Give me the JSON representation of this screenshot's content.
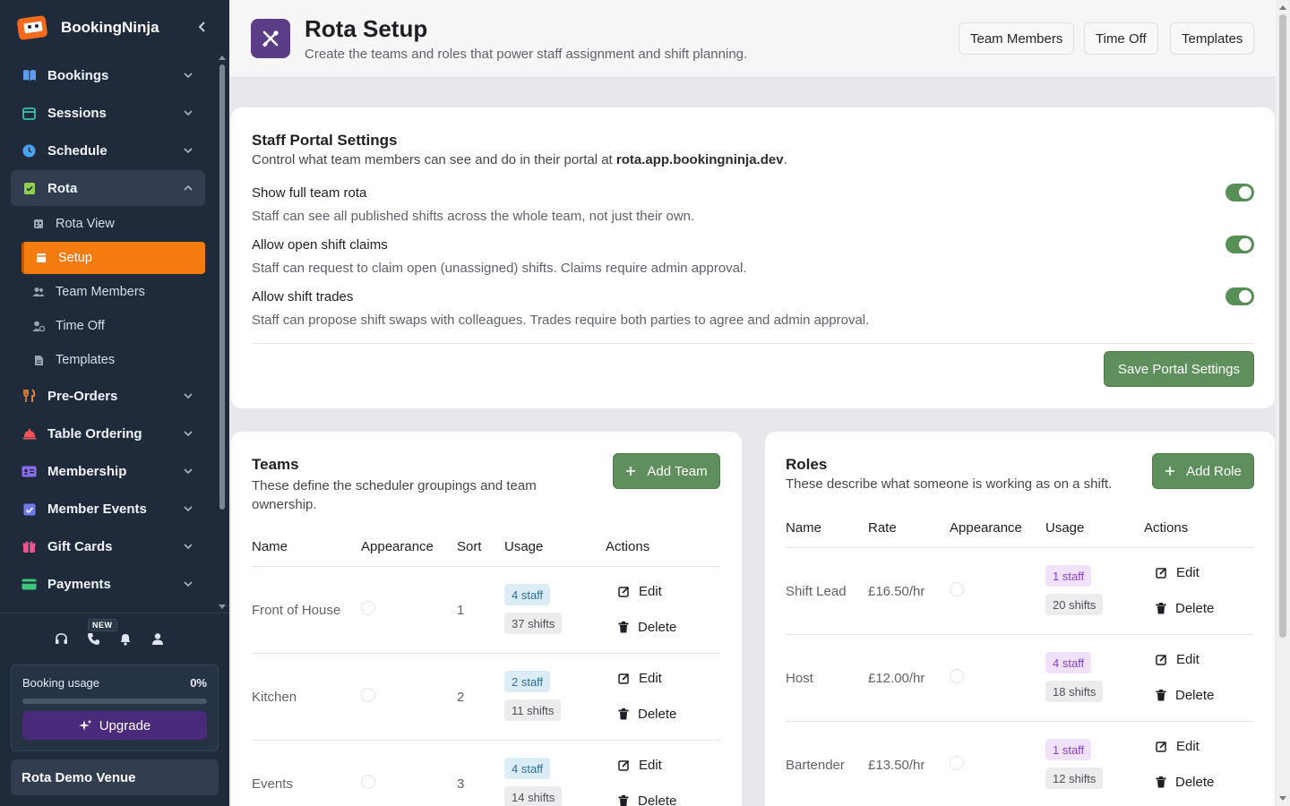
{
  "brand": {
    "name": "BookingNinja"
  },
  "sidebar": {
    "items": [
      {
        "label": "Bookings",
        "icon": "book-icon",
        "color": "#5b9bf0"
      },
      {
        "label": "Sessions",
        "icon": "calendar-icon",
        "color": "#36c2b4"
      },
      {
        "label": "Schedule",
        "icon": "clock-icon",
        "color": "#4aa3f0"
      },
      {
        "label": "Rota",
        "icon": "clipboard-check-icon",
        "color": "#8fd14f"
      },
      {
        "label": "Pre-Orders",
        "icon": "utensils-icon",
        "color": "#f28a2e"
      },
      {
        "label": "Table Ordering",
        "icon": "cloche-icon",
        "color": "#f2545b"
      },
      {
        "label": "Membership",
        "icon": "id-card-icon",
        "color": "#8b6cf0"
      },
      {
        "label": "Member Events",
        "icon": "calendar-check-icon",
        "color": "#6f7cf0"
      },
      {
        "label": "Gift Cards",
        "icon": "gift-icon",
        "color": "#e8558f"
      },
      {
        "label": "Payments",
        "icon": "credit-card-icon",
        "color": "#3ec67a"
      }
    ],
    "rota_sub": [
      {
        "label": "Rota View"
      },
      {
        "label": "Setup"
      },
      {
        "label": "Team Members"
      },
      {
        "label": "Time Off"
      },
      {
        "label": "Templates"
      }
    ],
    "new_badge": "NEW",
    "usage": {
      "label": "Booking usage",
      "percent_text": "0%",
      "percent": 0
    },
    "upgrade_label": "Upgrade",
    "venue": "Rota Demo Venue"
  },
  "header": {
    "title": "Rota Setup",
    "subtitle": "Create the teams and roles that power staff assignment and shift planning.",
    "buttons": [
      "Team Members",
      "Time Off",
      "Templates"
    ]
  },
  "portal": {
    "title": "Staff Portal Settings",
    "desc_prefix": "Control what team members can see and do in their portal at ",
    "domain": "rota.app.bookingninja.dev",
    "desc_suffix": ".",
    "settings": [
      {
        "label": "Show full team rota",
        "desc": "Staff can see all published shifts across the whole team, not just their own.",
        "enabled": true
      },
      {
        "label": "Allow open shift claims",
        "desc": "Staff can request to claim open (unassigned) shifts. Claims require admin approval.",
        "enabled": true
      },
      {
        "label": "Allow shift trades",
        "desc": "Staff can propose shift swaps with colleagues. Trades require both parties to agree and admin approval.",
        "enabled": true
      }
    ],
    "save_label": "Save Portal Settings"
  },
  "teams": {
    "title": "Teams",
    "desc": "These define the scheduler groupings and team ownership.",
    "add_label": "Add Team",
    "columns": [
      "Name",
      "Appearance",
      "Sort",
      "Usage",
      "Actions"
    ],
    "rows": [
      {
        "name": "Front of House",
        "sort": "1",
        "staff": "4 staff",
        "shifts": "37 shifts"
      },
      {
        "name": "Kitchen",
        "sort": "2",
        "staff": "2 staff",
        "shifts": "11 shifts"
      },
      {
        "name": "Events",
        "sort": "3",
        "staff": "4 staff",
        "shifts": "14 shifts"
      }
    ]
  },
  "roles": {
    "title": "Roles",
    "desc": "These describe what someone is working as on a shift.",
    "add_label": "Add Role",
    "columns": [
      "Name",
      "Rate",
      "Appearance",
      "Usage",
      "Actions"
    ],
    "rows": [
      {
        "name": "Shift Lead",
        "rate": "£16.50/hr",
        "staff": "1 staff",
        "shifts": "20 shifts"
      },
      {
        "name": "Host",
        "rate": "£12.00/hr",
        "staff": "4 staff",
        "shifts": "18 shifts"
      },
      {
        "name": "Bartender",
        "rate": "£13.50/hr",
        "staff": "1 staff",
        "shifts": "12 shifts"
      }
    ]
  },
  "actions": {
    "edit": "Edit",
    "delete": "Delete"
  },
  "colors": {
    "accent_orange": "#f57c0f",
    "success_green": "#5f8f5c",
    "page_icon_purple": "#5b3d86"
  }
}
